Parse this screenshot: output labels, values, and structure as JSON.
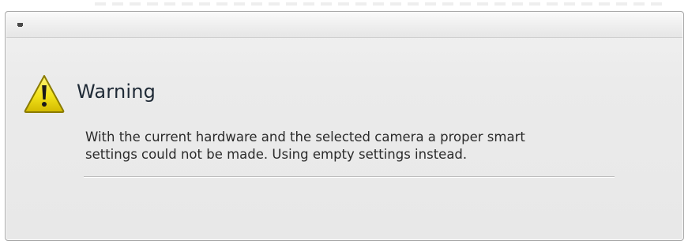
{
  "dialog": {
    "icon": "warning-icon",
    "heading": "Warning",
    "message_lines": [
      "With the current hardware and the selected camera a proper smart",
      "settings could not be made. Using empty settings instead."
    ]
  },
  "colors": {
    "warning_fill": "#f2e21a",
    "warning_border": "#8a7b00",
    "heading_text": "#1f2a36",
    "body_text": "#2b2b2b"
  }
}
